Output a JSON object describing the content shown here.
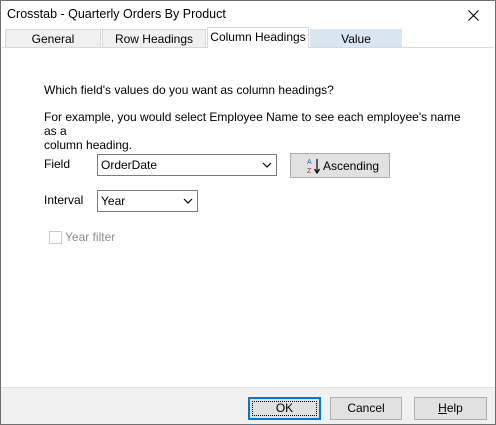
{
  "window": {
    "title": "Crosstab - Quarterly Orders By Product"
  },
  "tabs": [
    {
      "label": "General"
    },
    {
      "label": "Row Headings"
    },
    {
      "label": "Column Headings"
    },
    {
      "label": "Value"
    }
  ],
  "active_tab": "Column Headings",
  "content": {
    "question": "Which field's values do you want as column headings?",
    "example_line1": "For example, you would select Employee Name to see each employee's name as a",
    "example_line2": "column heading."
  },
  "field": {
    "label": "Field",
    "value": "OrderDate"
  },
  "sort": {
    "label": "Ascending",
    "icon": "sort-az-icon"
  },
  "interval": {
    "label": "Interval",
    "value": "Year"
  },
  "year_filter": {
    "label": "Year filter",
    "checked": false,
    "enabled": false
  },
  "buttons": {
    "ok": "OK",
    "cancel": "Cancel",
    "help_prefix": "",
    "help_underlined": "H",
    "help_suffix": "elp"
  },
  "colors": {
    "focus_accent": "#0078d7",
    "hover_tab": "#d8e6f2",
    "disabled_text": "#8d8d8d"
  }
}
